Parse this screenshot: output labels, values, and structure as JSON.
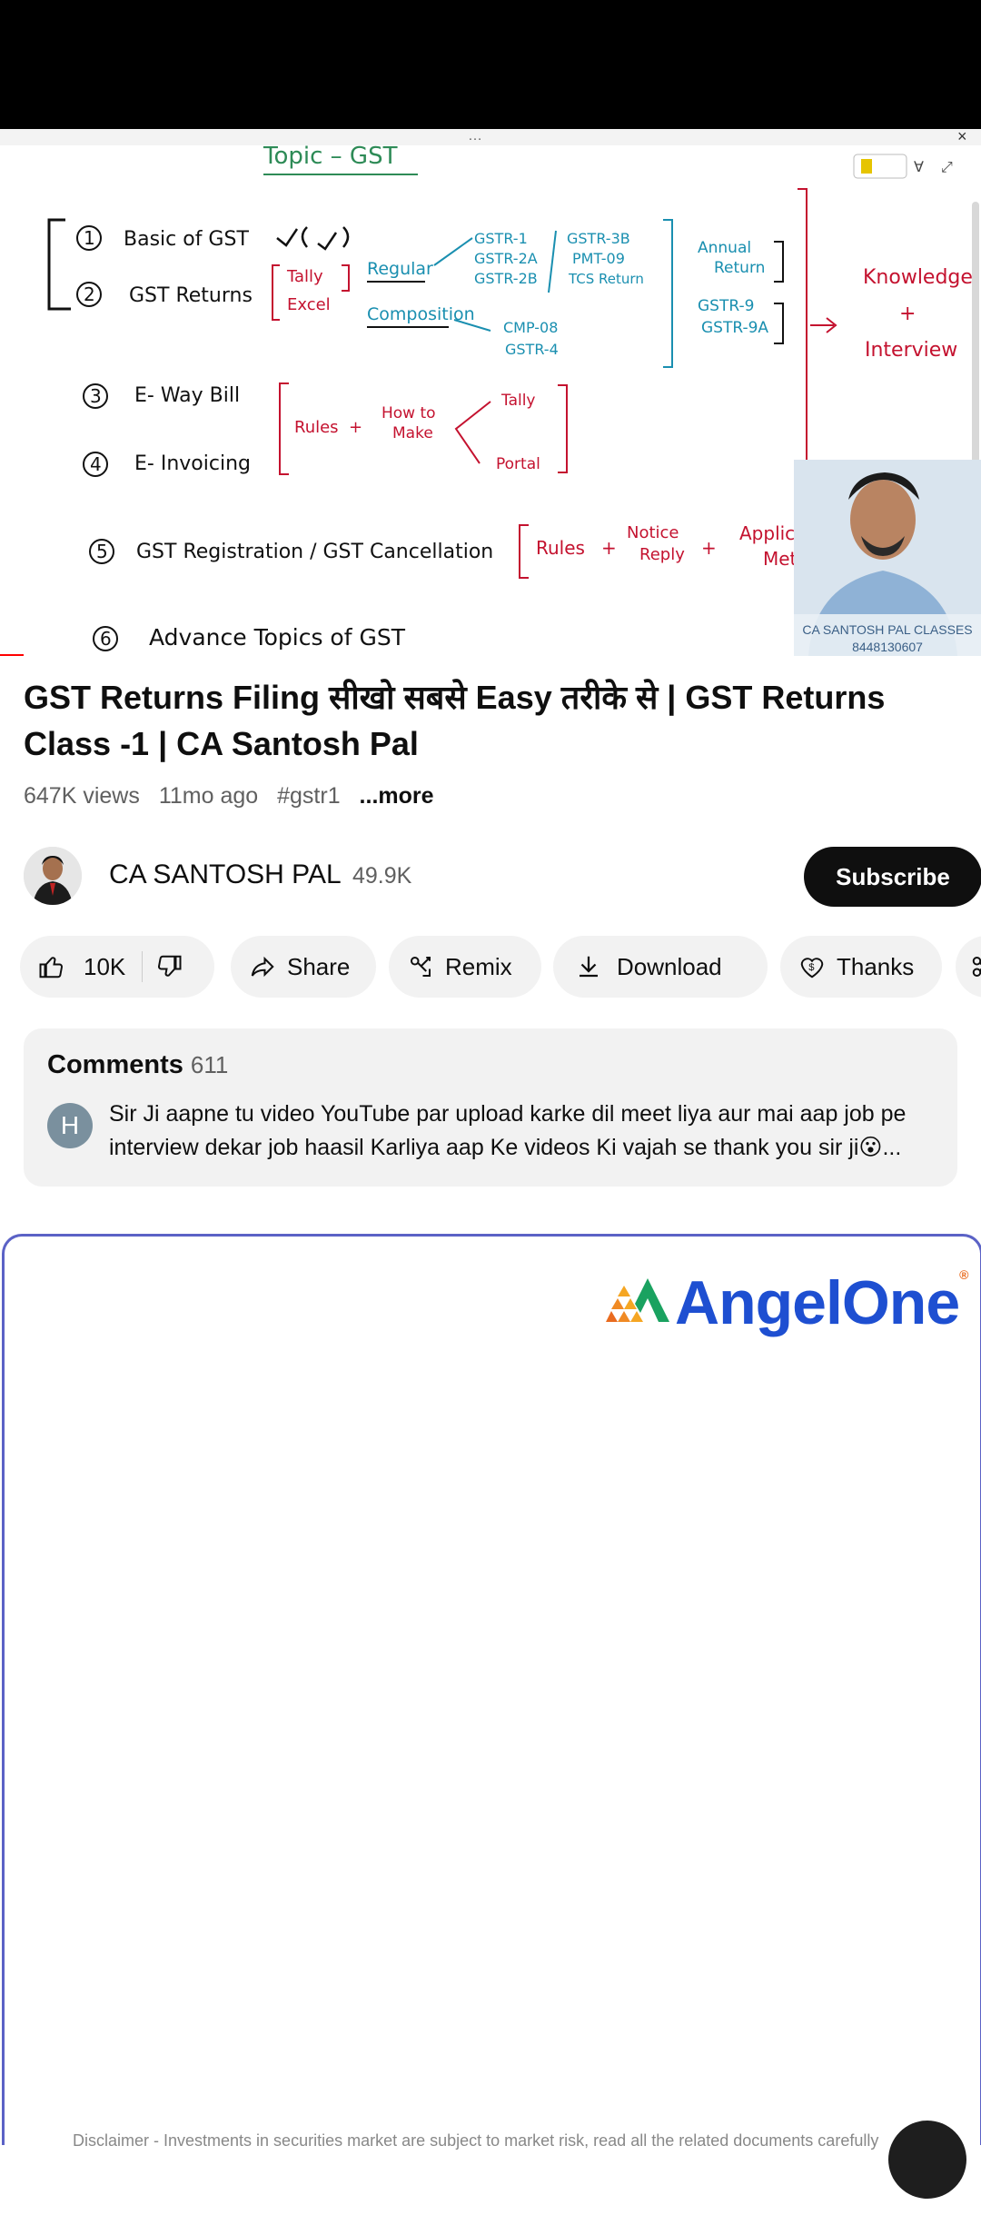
{
  "video": {
    "whiteboard": {
      "topic": "Topic – GST",
      "items": [
        "Basic of GST",
        "GST Returns",
        "E- Way Bill",
        "E- Invoicing",
        "GST Registration / GST Cancellation",
        "Advance Topics of GST"
      ],
      "numbers": [
        "1",
        "2",
        "3",
        "4",
        "5",
        "6"
      ],
      "tally": "Tally",
      "excel": "Excel",
      "regular": "Regular",
      "composition": "Composition",
      "gstr_left": [
        "GSTR-1",
        "GSTR-2A",
        "GSTR-2B"
      ],
      "gstr_mid": [
        "GSTR-3B",
        "PMT-09",
        "TCS Return"
      ],
      "cmp": [
        "CMP-08",
        "GSTR-4"
      ],
      "annual": [
        "Annual",
        "Return"
      ],
      "gstr9": [
        "GSTR-9",
        "GSTR-9A"
      ],
      "knowledge": [
        "Knowledge",
        "+",
        "Interview"
      ],
      "rules": "Rules",
      "plus": "+",
      "howto": [
        "How to",
        "Make"
      ],
      "tally_portal": [
        "Tally",
        "Portal"
      ],
      "notice": [
        "Notice",
        "Reply"
      ],
      "application": [
        "Application",
        "Method"
      ],
      "overlay_name": "CA SANTOSH PAL CLASSES",
      "overlay_phone": "8448130607"
    }
  },
  "title": "GST Returns Filing सीखो सबसे Easy तरीके से | GST Returns Class -1 | CA Santosh Pal",
  "meta": {
    "views": "647K views",
    "age": "11mo ago",
    "hashtag": "#gstr1",
    "more": "...more"
  },
  "channel": {
    "name": "CA SANTOSH PAL",
    "subscribers": "49.9K",
    "subscribe_label": "Subscribe"
  },
  "actions": {
    "likes": "10K",
    "share": "Share",
    "remix": "Remix",
    "download": "Download",
    "thanks": "Thanks"
  },
  "comments": {
    "heading": "Comments",
    "count": "611",
    "avatar_letter": "H",
    "top_comment": "Sir Ji aapne tu video YouTube par upload karke dil meet liya aur mai aap job pe interview dekar job haasil Karliya aap Ke videos Ki  vajah se thank you sir ji😮..."
  },
  "ad": {
    "brand_a": "Angel",
    "brand_b": "One",
    "disclaimer": "Disclaimer - Investments in securities market are subject to market risk, read all the related documents carefully"
  },
  "colors": {
    "accent_red": "#ff0000",
    "ink_green": "#2e8b57",
    "ink_red": "#c4122f",
    "ink_cyan": "#1a8fb0",
    "ad_border": "#5b62c6",
    "brand_blue": "#1e4fd1"
  }
}
